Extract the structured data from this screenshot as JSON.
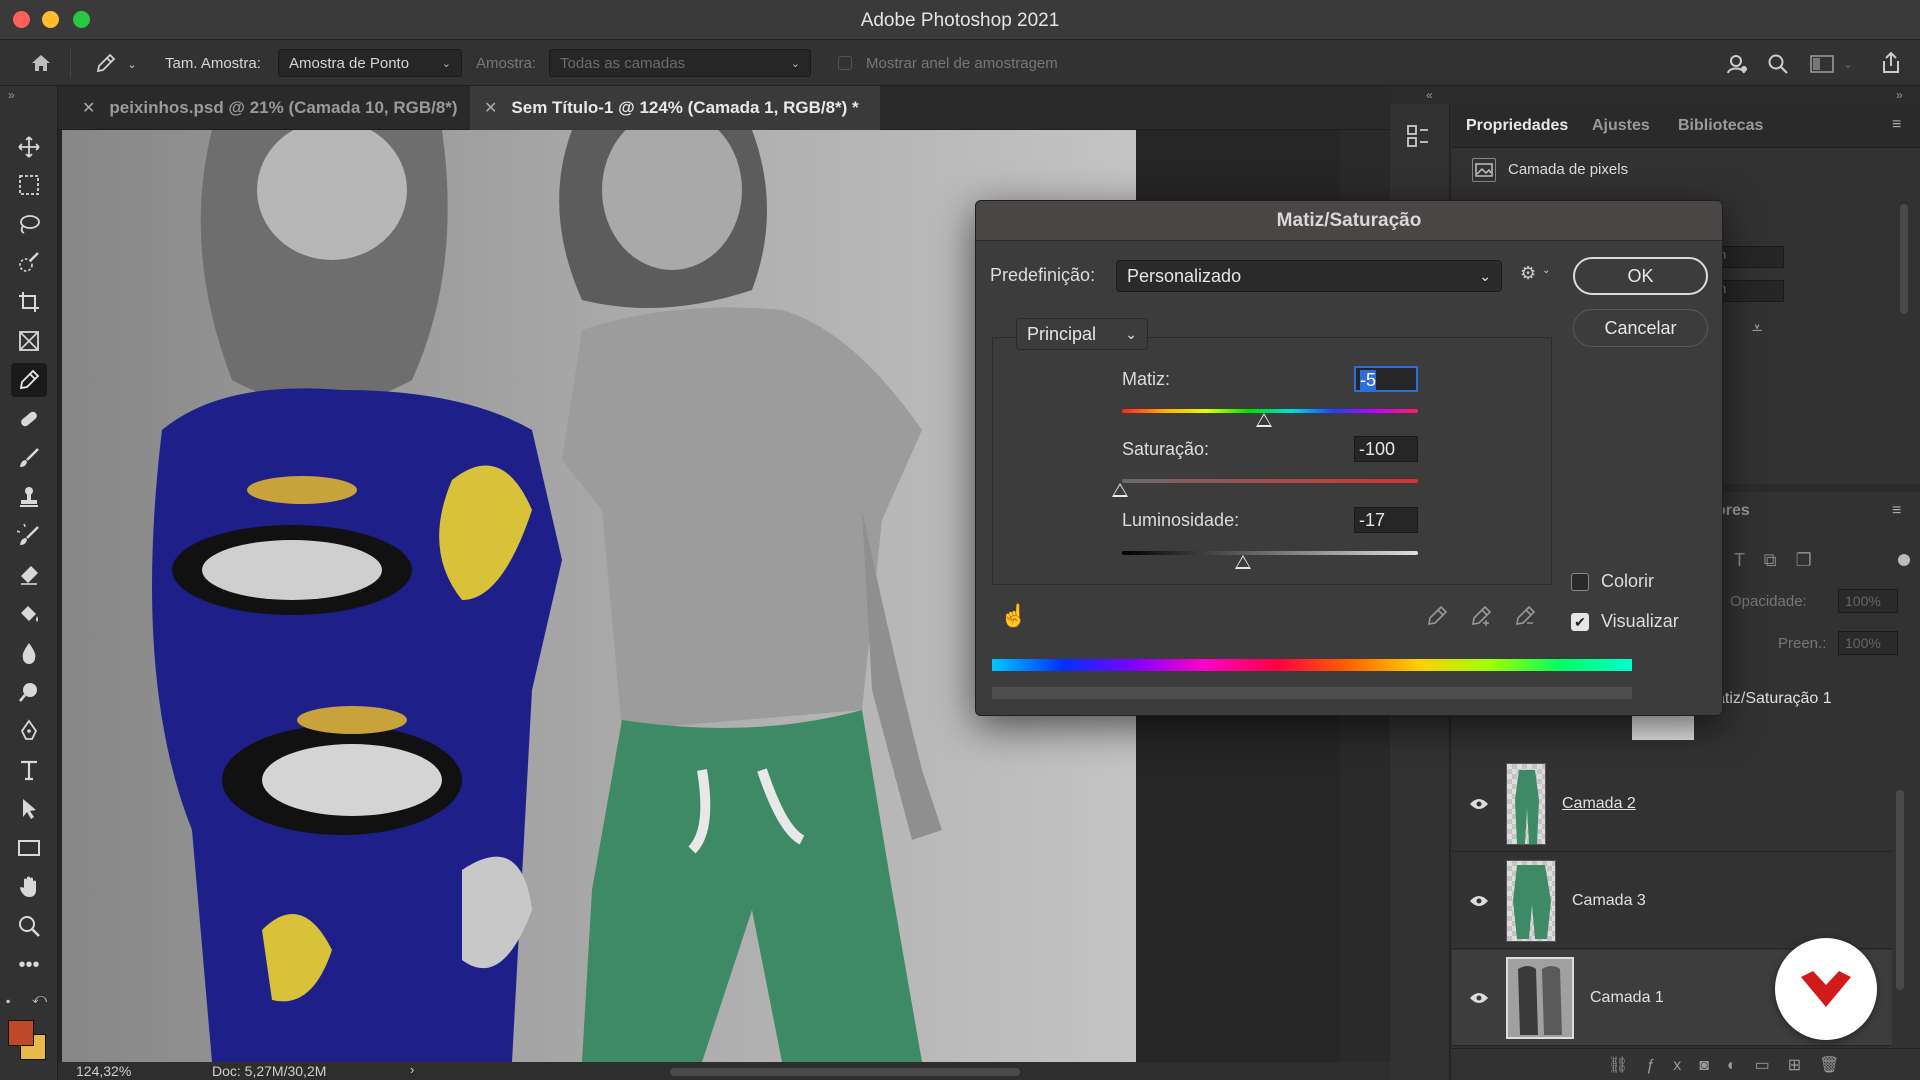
{
  "app": {
    "title": "Adobe Photoshop 2021"
  },
  "options_bar": {
    "sample_size_label": "Tam. Amostra:",
    "sample_size_value": "Amostra de Ponto",
    "sample_label": "Amostra:",
    "sample_value": "Todas as camadas",
    "show_ring_label": "Mostrar anel de amostragem"
  },
  "doc_tabs": [
    {
      "label": "peixinhos.psd @ 21% (Camada 10, RGB/8*)",
      "active": false
    },
    {
      "label": "Sem Título-1 @ 124% (Camada 1, RGB/8*) *",
      "active": true
    }
  ],
  "status": {
    "zoom": "124,32%",
    "doc": "Doc: 5,27M/30,2M"
  },
  "panel": {
    "tabs": [
      "Propriedades",
      "Ajustes",
      "Bibliotecas"
    ],
    "pixel_layer_label": "Camada de pixels",
    "layers_partial_tab": "ores",
    "opacity_label": "Opacidade:",
    "opacity_value": "100%",
    "fill_label": "Preen.:",
    "fill_value": "100%",
    "adjustment_layer_partial": "atiz/Saturação 1"
  },
  "layers": [
    {
      "name": "Camada 2",
      "visible": true,
      "underlined": true
    },
    {
      "name": "Camada 3",
      "visible": true,
      "underlined": false
    },
    {
      "name": "Camada 1",
      "visible": true,
      "underlined": false
    }
  ],
  "dialog": {
    "title": "Matiz/Saturação",
    "preset_label": "Predefinição:",
    "preset_value": "Personalizado",
    "channel_value": "Principal",
    "ok_label": "OK",
    "cancel_label": "Cancelar",
    "hue_label": "Matiz:",
    "hue_value": "-5",
    "saturation_label": "Saturação:",
    "saturation_value": "-100",
    "lightness_label": "Luminosidade:",
    "lightness_value": "-17",
    "colorize_label": "Colorir",
    "colorize_checked": false,
    "preview_label": "Visualizar",
    "preview_checked": true
  },
  "colors": {
    "foreground": "#c0482a",
    "background": "#e8b84a",
    "accent_focus": "#2f6ed8"
  }
}
